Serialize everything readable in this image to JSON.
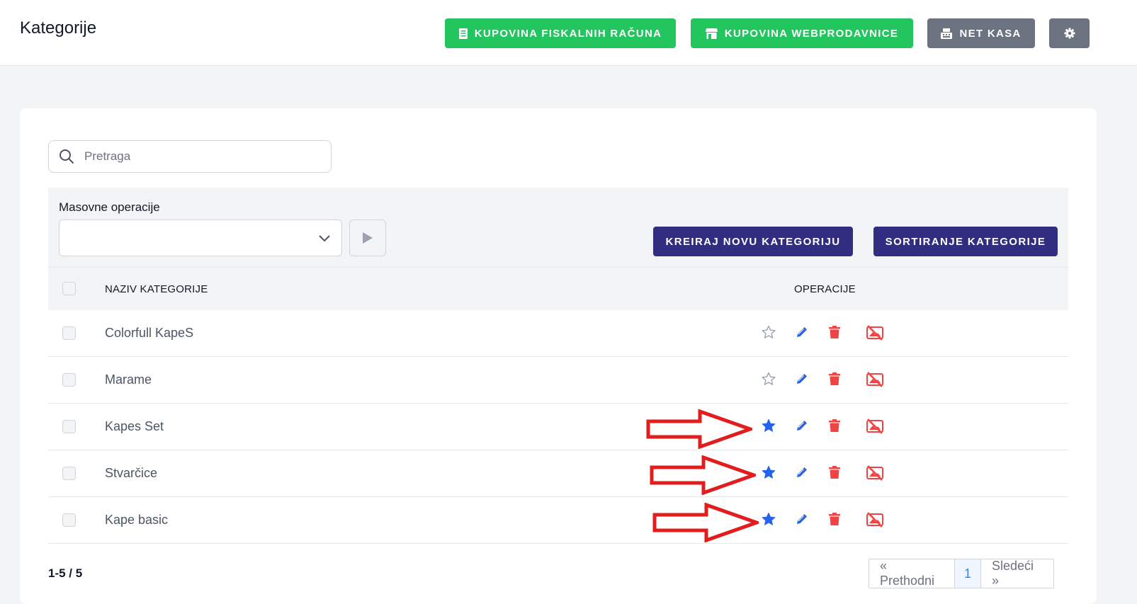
{
  "header": {
    "title": "Kategorije",
    "buttons": {
      "fiscal": "KUPOVINA FISKALNIH RAČUNA",
      "webshop": "KUPOVINA WEBPRODAVNICE",
      "netkasa": "NET KASA"
    }
  },
  "search": {
    "placeholder": "Pretraga"
  },
  "mass": {
    "label": "Masovne operacije",
    "selected": ""
  },
  "actions": {
    "create": "KREIRAJ NOVU KATEGORIJU",
    "sort": "SORTIRANJE KATEGORIJE"
  },
  "table": {
    "columns": {
      "name": "NAZIV KATEGORIJE",
      "ops": "OPERACIJE"
    },
    "rows": [
      {
        "name": "Colorfull KapeS",
        "featured": false
      },
      {
        "name": "Marame",
        "featured": false
      },
      {
        "name": "Kapes Set",
        "featured": true
      },
      {
        "name": "Stvarčice",
        "featured": true
      },
      {
        "name": "Kape basic",
        "featured": true
      }
    ]
  },
  "footer": {
    "count": "1-5 / 5",
    "pager": {
      "prev": "« Prethodni",
      "current": "1",
      "next": "Sledeći »"
    }
  },
  "colors": {
    "green": "#22c55e",
    "gray": "#6b7280",
    "indigo": "#312e81",
    "blue": "#2563eb",
    "red": "#ef4444",
    "annotation": "#e11d1d"
  },
  "icons": [
    "receipt-icon",
    "store-icon",
    "cash-register-icon",
    "gear-icon",
    "search-icon",
    "chevron-down-icon",
    "play-icon",
    "star-icon",
    "pencil-icon",
    "trash-icon",
    "hide-image-icon",
    "arrow-annotation-icon"
  ]
}
